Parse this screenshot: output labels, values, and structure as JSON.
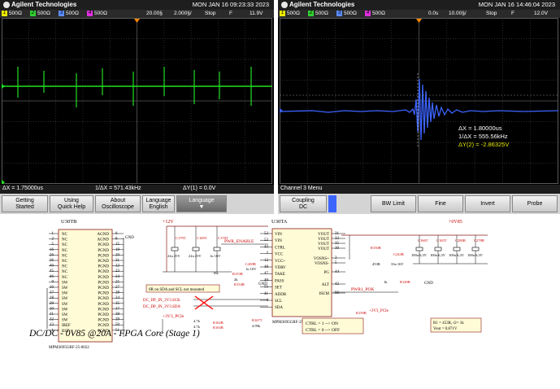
{
  "scope1": {
    "brand": "Agilent Technologies",
    "datetime": "MON JAN 16 09:23:33 2023",
    "channels": [
      {
        "num": "1",
        "scale": "500Ω",
        "color": "#e8e800"
      },
      {
        "num": "2",
        "scale": "500Ω",
        "color": "#30d030"
      },
      {
        "num": "3",
        "scale": "500Ω",
        "color": "#5a8cff"
      },
      {
        "num": "4",
        "scale": "500Ω",
        "color": "#e030e0"
      }
    ],
    "timebase": "20.00§",
    "timebase2": "2.000§/",
    "run_state": "Stop",
    "trigger": "F",
    "trig_level": "11.9V",
    "status": {
      "dx": "ΔX = 1.75000us",
      "inv": "1/ΔX = 571.43kHz",
      "dy": "ΔY(1) = 0.0V"
    },
    "softkeys": [
      {
        "l1": "Getting",
        "l2": "Started"
      },
      {
        "l1": "Using",
        "l2": "Quick Help"
      },
      {
        "l1": "About",
        "l2": "Oscilloscope"
      },
      {
        "l1": "Language",
        "l2": "English"
      },
      {
        "l1": "Language",
        "l2": ""
      }
    ],
    "trace_color": "#22e022"
  },
  "scope2": {
    "brand": "Agilent Technologies",
    "datetime": "MON JAN 16 14:46:04 2023",
    "channels": [
      {
        "num": "1",
        "scale": "500Ω",
        "color": "#e8e800"
      },
      {
        "num": "2",
        "scale": "500Ω",
        "color": "#30d030"
      },
      {
        "num": "3",
        "scale": "500Ω",
        "color": "#5a8cff"
      },
      {
        "num": "4",
        "scale": "500Ω",
        "color": "#e030e0"
      }
    ],
    "timebase": "0.0s",
    "timebase2": "10.00§/",
    "run_state": "Stop",
    "trigger": "F",
    "trig_level": "12.0V",
    "measurements": {
      "dx": "ΔX = 1.80000us",
      "inv": "1/ΔX = 555.56kHz",
      "dy": "ΔY(2) = -2.86325V"
    },
    "menu_label": "Channel 3  Menu",
    "softkeys": [
      {
        "l1": "Coupling",
        "l2": "DC"
      },
      {
        "l1": "BW Limit",
        "l2": ""
      },
      {
        "l1": "Fine",
        "l2": ""
      },
      {
        "l1": "Invert",
        "l2": ""
      },
      {
        "l1": "Probe",
        "l2": ""
      }
    ],
    "trace_color": "#3c64ff"
  },
  "schematic": {
    "caption": "DC/DC - 0V85 @20A - FPGA Core (Stage 1)",
    "u30b": {
      "ref": "U30TB",
      "part": "MPM3695GRF-25-0022",
      "left_labels": [
        "NC",
        "NC",
        "NC",
        "NC",
        "NC",
        "NC",
        "NC",
        "NC",
        "NC",
        "SW",
        "SW",
        "SW",
        "SW",
        "SW",
        "SW",
        "SW",
        "SW",
        "IREF",
        "BST"
      ],
      "left_pins": [
        "1",
        "2",
        "5",
        "16",
        "26",
        "36",
        "40",
        "45",
        "46",
        "9",
        "10",
        "17",
        "18",
        "29",
        "30",
        "31",
        "32",
        "13",
        "1"
      ],
      "right_labels": [
        "AGND",
        "AGND",
        "PGND",
        "PGND",
        "PGND",
        "PGND",
        "PGND",
        "PGND",
        "PGND",
        "PGND",
        "PGND",
        "PGND",
        "PGND",
        "PGND",
        "PGND",
        "PGND",
        "PGND",
        "PGND",
        "PGND"
      ],
      "right_pins": [
        "6",
        "8",
        "15",
        "19",
        "20",
        "21",
        "22",
        "23",
        "24",
        "25",
        "27",
        "28",
        "34",
        "35",
        "37",
        "38",
        "39",
        "50",
        "51"
      ]
    },
    "u30a": {
      "ref": "U30TA",
      "part": "MPM3695GRF-25-0022",
      "left_labels": [
        "VIN",
        "VIN",
        "CTRL",
        "VCC",
        "VCC+",
        "VDRV",
        "TAKE",
        "PASS",
        "SET",
        "ADDR",
        "SCL",
        "SDA"
      ],
      "left_pins": [
        "52",
        "53",
        "43",
        "7",
        "12",
        "48",
        "47",
        "49",
        "55",
        "41",
        "4"
      ],
      "right_labels": [
        "VOUT",
        "VOUT",
        "VOUT",
        "VOUT",
        "VOSNS+",
        "VOSNS-",
        "PG",
        "ALT",
        "ISUM"
      ],
      "right_pins": [
        "31",
        "33",
        "35",
        "30",
        "3",
        "5",
        "44",
        "42",
        "56"
      ]
    },
    "power_in": "+12V",
    "power_out": "+0V85",
    "power_3v3": "+3V3_PCIe",
    "input_caps": [
      {
        "ref": "C179T",
        "val": "22u 25V"
      },
      {
        "ref": "C169T",
        "val": "22u 25V"
      },
      {
        "ref": "C178T",
        "val": "1u 16V"
      }
    ],
    "output_caps": [
      {
        "ref": "C166T",
        "val": "100u 6,3V"
      },
      {
        "ref": "C165T",
        "val": "100u 6,3V"
      },
      {
        "ref": "C280B",
        "val": "100u 6,3V"
      },
      {
        "ref": "C278B",
        "val": "100u 6,3V"
      }
    ],
    "pwr_enable": "PWR_ENABLE",
    "pwr1_pok": "PWR1_POK",
    "i2c_scl": "DC_DP_IN_3V3.SCK",
    "i2c_sda": "DC_DP_IN_3V3.SDA",
    "note_i2c": "0R on SDA and SCL not mounted",
    "note_ctrl_1": "CTRL = 1 --> ON",
    "note_ctrl_2": "CTRL = 0 --> OFF",
    "note_r1": "R1 = 453R, r2= 1k",
    "note_vout": "Vout = 0.871V",
    "gnd": "GND",
    "passives": [
      {
        "ref": "R150B",
        "val": "453R"
      },
      {
        "ref": "C243B",
        "val": "33n 16V"
      },
      {
        "ref": "R149B",
        "val": "1k"
      },
      {
        "ref": "R159B",
        "val": "10k"
      },
      {
        "ref": "C269B",
        "val": "1u 16V"
      },
      {
        "ref": "R153B",
        "val": "18k"
      },
      {
        "ref": "R154B",
        "val": "2k"
      },
      {
        "ref": "R167T",
        "val": "4.99k"
      },
      {
        "ref": "R162B",
        "val": "4.7k"
      },
      {
        "ref": "R163B",
        "val": "4.7k"
      }
    ]
  }
}
